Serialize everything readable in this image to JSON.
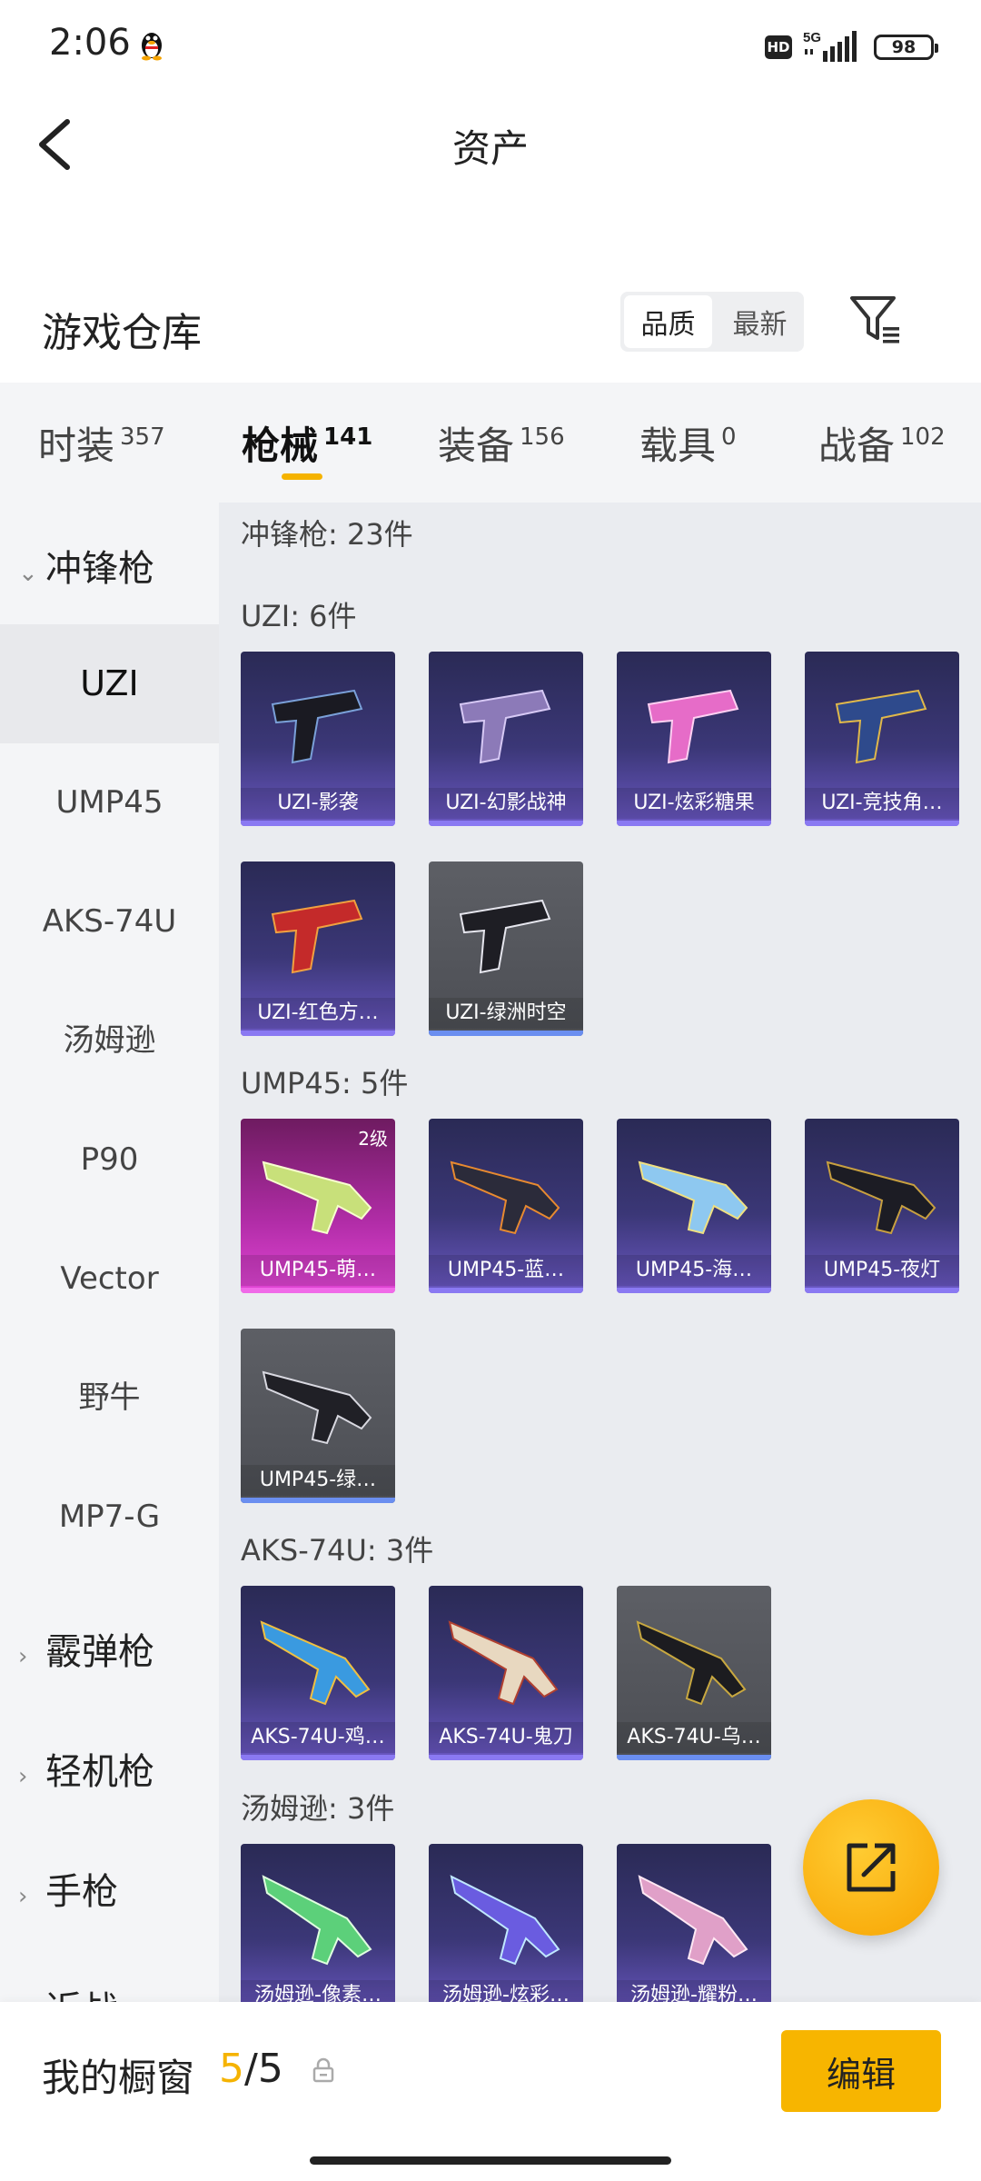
{
  "status_bar": {
    "time": "2:06",
    "hd": "HD",
    "network": "5G",
    "battery": "98"
  },
  "header": {
    "title": "资产"
  },
  "warehouse": {
    "title": "游戏仓库",
    "sort_quality": "品质",
    "sort_newest": "最新"
  },
  "category_tabs": [
    {
      "label": "时装",
      "count": "357"
    },
    {
      "label": "枪械",
      "count": "141"
    },
    {
      "label": "装备",
      "count": "156"
    },
    {
      "label": "载具",
      "count": "0"
    },
    {
      "label": "战备",
      "count": "102"
    }
  ],
  "sidebar": {
    "group_smg": "冲锋枪",
    "items": [
      "UZI",
      "UMP45",
      "AKS-74U",
      "汤姆逊",
      "P90",
      "Vector",
      "野牛",
      "MP7-G"
    ],
    "group_shotgun": "霰弹枪",
    "group_lmg": "轻机枪",
    "group_pistol": "手枪",
    "group_melee": "近战"
  },
  "content": {
    "smg_total": "冲锋枪: 23件",
    "uzi": {
      "label": "UZI: 6件",
      "items": [
        "UZI-影袭",
        "UZI-幻影战神",
        "UZI-炫彩糖果",
        "UZI-竞技角…",
        "UZI-红色方…",
        "UZI-绿洲时空"
      ]
    },
    "ump45": {
      "label": "UMP45: 5件",
      "items": [
        "UMP45-萌…",
        "UMP45-蓝…",
        "UMP45-海…",
        "UMP45-夜灯",
        "UMP45-绿…"
      ],
      "level_badge": "2级"
    },
    "aks74u": {
      "label": "AKS-74U: 3件",
      "items": [
        "AKS-74U-鸡…",
        "AKS-74U-鬼刀",
        "AKS-74U-乌…"
      ]
    },
    "thompson": {
      "label": "汤姆逊: 3件",
      "items": [
        "汤姆逊-像素…",
        "汤姆逊-炫彩…",
        "汤姆逊-耀粉…"
      ]
    }
  },
  "bottom_bar": {
    "showcase_label": "我的橱窗",
    "showcase_current": "5",
    "showcase_total": "/5",
    "edit_label": "编辑"
  },
  "colors": {
    "accent": "#f7b500",
    "card_purple": "#3b3777",
    "card_grey": "#55575d",
    "card_pink": "#c433b8"
  },
  "icons": {
    "back": "chevron-left-icon",
    "filter": "filter-icon",
    "share": "share-icon",
    "lock": "lock-icon",
    "qq": "qq-penguin-icon"
  }
}
